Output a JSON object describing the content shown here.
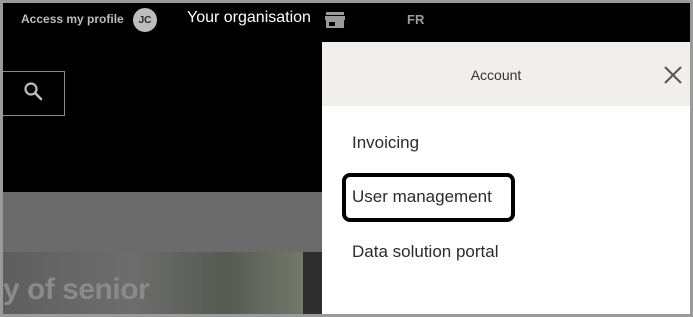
{
  "topbar": {
    "profile_label": "Access my profile",
    "avatar_initials": "JC",
    "organisation_label": "Your organisation",
    "store_icon": "store-icon",
    "language": "FR"
  },
  "search": {
    "icon": "search-icon"
  },
  "hero": {
    "text": "y of senior"
  },
  "panel": {
    "title": "Account",
    "close_icon": "close-icon",
    "items": [
      {
        "label": "Invoicing"
      },
      {
        "label": "User management",
        "highlighted": true
      },
      {
        "label": "Data solution portal"
      }
    ]
  },
  "colors": {
    "background_dark": "#000000",
    "panel_header": "#f1efec",
    "panel_bg": "#ffffff",
    "highlight_border": "#000000"
  }
}
